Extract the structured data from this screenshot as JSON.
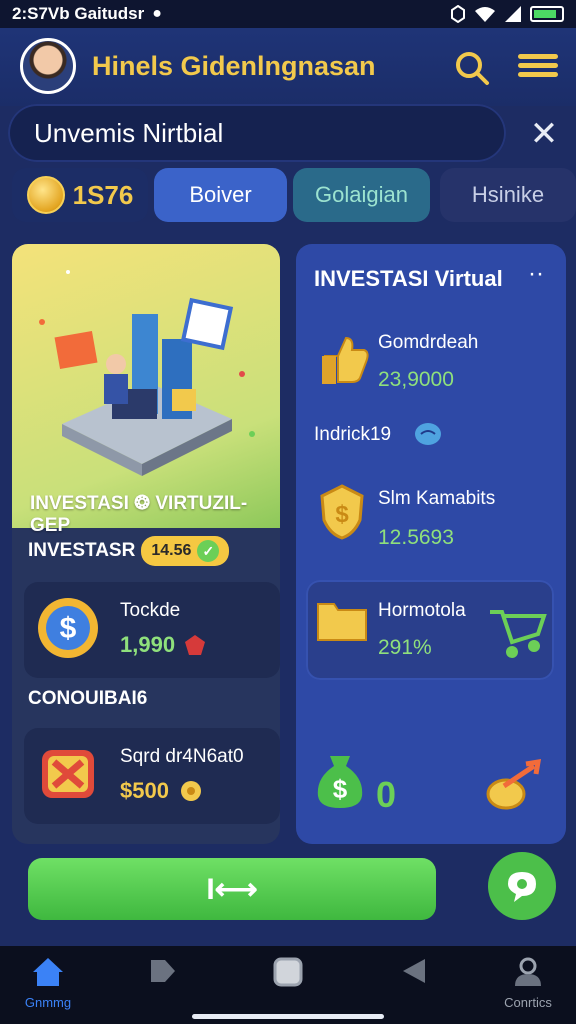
{
  "status_bar": {
    "time_text": "2:S7Vb Gaitudsr",
    "notification_glyph": "●"
  },
  "header": {
    "title": "Hinels Gidenlngnasan"
  },
  "search": {
    "value": "Unvemis Nirtbial",
    "clear_glyph": "✕"
  },
  "balance": {
    "coins": "1S76"
  },
  "tabs": [
    {
      "label": "Boiver"
    },
    {
      "label": "Golaigian"
    },
    {
      "label": "Hsinike"
    }
  ],
  "left_card": {
    "hero_title": "INVESTASI ❂ VIRTUZIL-GEP",
    "row_label": "INVESTASR",
    "row_pill": "14.56",
    "item1": {
      "title": "Tockde",
      "value": "1,990"
    },
    "section_title": "CONOUIBAI6",
    "item2": {
      "title": "Sqrd dr4N6at0",
      "value": "$500"
    }
  },
  "right_card": {
    "title": "INVESTASI Virtual",
    "more_glyph": "··",
    "item1": {
      "title": "Gomdrdeah",
      "value": "23,9000"
    },
    "mid_label": "Indrick19",
    "item2": {
      "title": "Slm Kamabits",
      "value": "12.5693"
    },
    "item3": {
      "title": "Hormotola",
      "value": "291%"
    },
    "bottom_value": "0"
  },
  "action": {
    "primary_label": "I⟷"
  },
  "bottom_nav": [
    {
      "label": "Gnmmg",
      "icon": "home-icon",
      "color": "#3b82f6"
    },
    {
      "label": "",
      "icon": "play-icon"
    },
    {
      "label": "",
      "icon": "square-icon"
    },
    {
      "label": "",
      "icon": "back-icon"
    },
    {
      "label": "Conrtics",
      "icon": "profile-icon"
    }
  ],
  "colors": {
    "accent_gold": "#f2c94c",
    "accent_green": "#6ccf57",
    "primary_blue": "#3b63c9"
  }
}
